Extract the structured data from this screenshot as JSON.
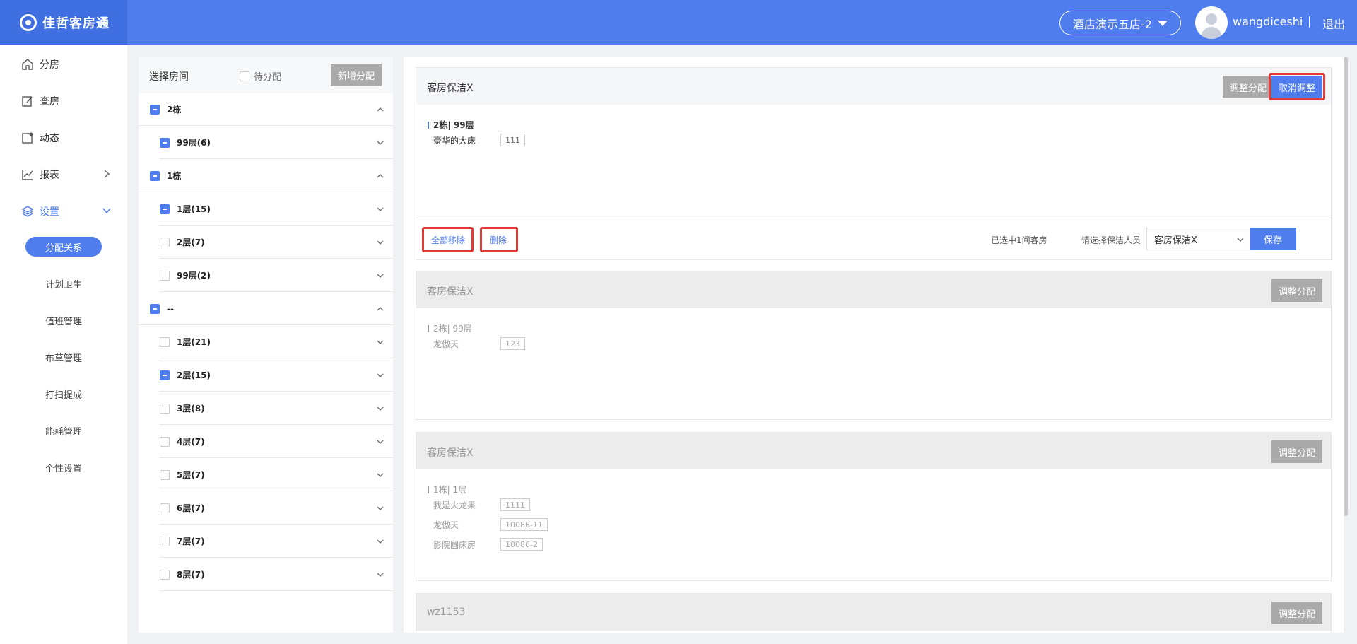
{
  "header": {
    "brand": "佳哲客房通",
    "hotel": "酒店演示五店-2",
    "username": "wangdiceshi",
    "logout": "退出"
  },
  "sidebar": {
    "items": [
      {
        "label": "分房",
        "icon": "home-icon"
      },
      {
        "label": "查房",
        "icon": "edit-icon"
      },
      {
        "label": "动态",
        "icon": "window-icon"
      },
      {
        "label": "报表",
        "icon": "chart-icon"
      },
      {
        "label": "设置",
        "icon": "layers-icon"
      }
    ],
    "sub_items": [
      "分配关系",
      "计划卫生",
      "值班管理",
      "布草管理",
      "打扫提成",
      "能耗管理",
      "个性设置"
    ]
  },
  "room_panel": {
    "title": "选择房间",
    "pending_label": "待分配",
    "add_button": "新增分配",
    "tree": [
      {
        "label": "2栋",
        "level": "building",
        "checked": true,
        "expanded": true
      },
      {
        "label": "99层(6)",
        "level": "floor",
        "checked": true
      },
      {
        "label": "1栋",
        "level": "building",
        "checked": true,
        "expanded": true
      },
      {
        "label": "1层(15)",
        "level": "floor",
        "checked": true
      },
      {
        "label": "2层(7)",
        "level": "floor",
        "checked": false
      },
      {
        "label": "99层(2)",
        "level": "floor",
        "checked": false
      },
      {
        "label": "--",
        "level": "building",
        "checked": true,
        "expanded": true
      },
      {
        "label": "1层(21)",
        "level": "floor",
        "checked": false
      },
      {
        "label": "2层(15)",
        "level": "floor",
        "checked": true
      },
      {
        "label": "3层(8)",
        "level": "floor",
        "checked": false
      },
      {
        "label": "4层(7)",
        "level": "floor",
        "checked": false
      },
      {
        "label": "5层(7)",
        "level": "floor",
        "checked": false
      },
      {
        "label": "6层(7)",
        "level": "floor",
        "checked": false
      },
      {
        "label": "7层(7)",
        "level": "floor",
        "checked": false
      },
      {
        "label": "8层(7)",
        "level": "floor",
        "checked": false
      }
    ]
  },
  "cards": [
    {
      "title": "客房保洁X",
      "adjust_label": "调整分配",
      "cancel_label": "取消调整",
      "group": "2栋| 99层",
      "rooms": [
        {
          "name": "豪华的大床",
          "no": "111"
        }
      ],
      "footer": {
        "remove_all": "全部移除",
        "delete": "删除",
        "selected_text": "已选中1间客房",
        "cleaner_label": "请选择保洁人员",
        "cleaner_value": "客房保洁X",
        "save": "保存"
      }
    },
    {
      "title": "客房保洁X",
      "adjust_label": "调整分配",
      "group": "2栋| 99层",
      "rooms": [
        {
          "name": "龙傲天",
          "no": "123"
        }
      ]
    },
    {
      "title": "客房保洁X",
      "adjust_label": "调整分配",
      "group": "1栋| 1层",
      "rooms": [
        {
          "name": "我是火龙果",
          "no": "1111"
        },
        {
          "name": "龙傲天",
          "no": "10086-11"
        },
        {
          "name": "影院圆床房",
          "no": "10086-2"
        }
      ]
    },
    {
      "title": "wz1153",
      "adjust_label": "调整分配"
    }
  ],
  "colors": {
    "primary": "#4f7ded",
    "header": "#4f7ded",
    "highlight": "#e53935"
  }
}
